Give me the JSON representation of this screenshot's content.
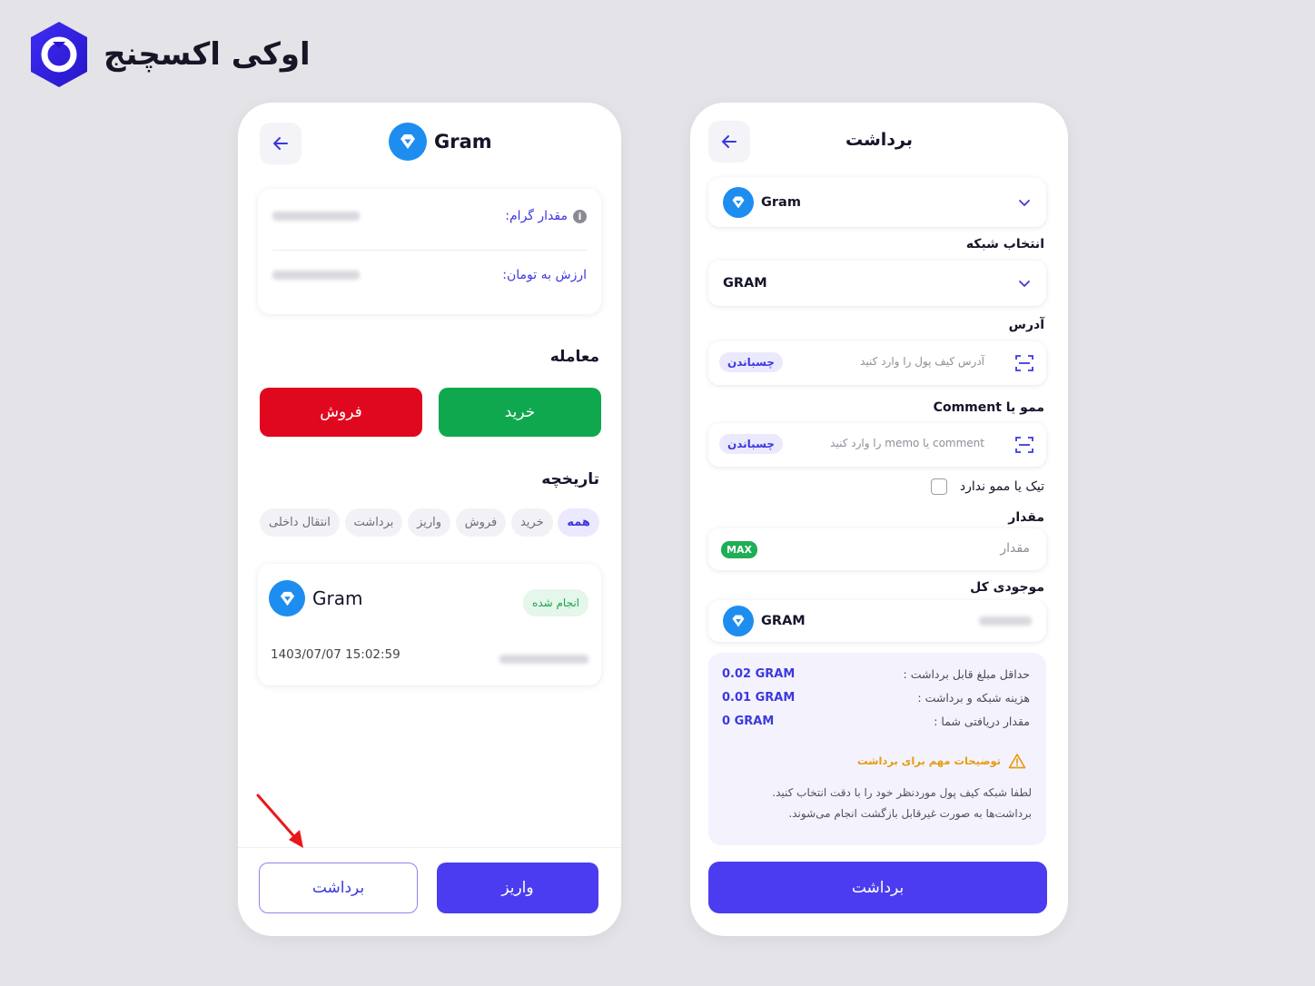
{
  "brand": {
    "name": "اوکی اکسچنج"
  },
  "colors": {
    "primary": "#4b3cf0",
    "buy": "#0fa84e",
    "sell": "#e0081e",
    "coin": "#1e8df0",
    "success": "#17a34a",
    "warning": "#e69b12"
  },
  "left_screen": {
    "coin_name": "Gram",
    "info": {
      "amount_label": "مقدار گرام:",
      "value_label": "ارزش به تومان:"
    },
    "trade": {
      "heading": "معامله",
      "buy_label": "خرید",
      "sell_label": "فروش"
    },
    "history": {
      "heading": "تاریخچه",
      "filters": [
        "همه",
        "خرید",
        "فروش",
        "واریز",
        "برداشت",
        "انتقال داخلی"
      ],
      "active_filter": "همه",
      "transaction": {
        "coin": "Gram",
        "status": "انجام شده",
        "date": "1403/07/07  15:02:59"
      }
    },
    "bottom": {
      "withdraw_label": "برداشت",
      "deposit_label": "واریز"
    }
  },
  "right_screen": {
    "title": "برداشت",
    "coin_select": "Gram",
    "network": {
      "label": "انتخاب شبکه",
      "value": "GRAM"
    },
    "address": {
      "label": "آدرس",
      "placeholder": "آدرس کیف پول را وارد کنید",
      "paste_label": "چسباندن"
    },
    "memo": {
      "label": "ممو یا Comment",
      "placeholder": "comment یا memo را وارد کنید",
      "paste_label": "چسباندن"
    },
    "no_memo_label": "تیک یا ممو ندارد",
    "amount": {
      "label": "مقدار",
      "placeholder": "مقدار",
      "max_label": "MAX"
    },
    "balance": {
      "label": "موجودی کل",
      "currency": "GRAM"
    },
    "fees": [
      {
        "label": "حداقل مبلغ قابل برداشت :",
        "value": "0.02 GRAM"
      },
      {
        "label": "هزینه شبکه و برداشت :",
        "value": "0.01 GRAM"
      },
      {
        "label": "مقدار دریافتی شما :",
        "value": "0 GRAM"
      }
    ],
    "warning_title": "توضیحات مهم برای برداشت",
    "warning_body": "لطفا شبکه کیف پول موردنظر خود را با دقت انتخاب کنید. برداشت‌ها به صورت غیرقابل بازگشت انجام می‌شوند.",
    "submit_label": "برداشت"
  }
}
